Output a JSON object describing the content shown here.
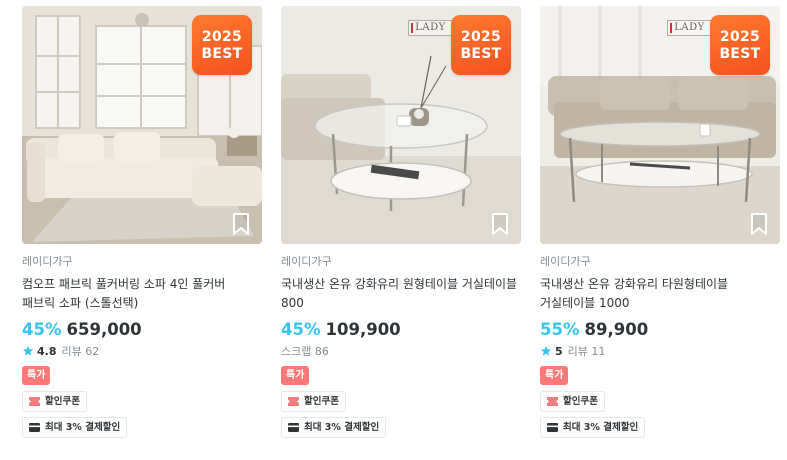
{
  "colors": {
    "discount": "#35c5f0",
    "best_badge": "#f4511e",
    "sale_badge": "#ff7777",
    "star": "#35c5f0",
    "coupon_icon": "#f47b7b",
    "text_muted": "#828c94"
  },
  "products": [
    {
      "badge": {
        "year": "2025",
        "label": "BEST"
      },
      "brand_text": "",
      "seller": "레이디가구",
      "title": "컴오프 패브릭 풀커버링 소파 4인 풀커버 패브릭 소파 (스톨선택)",
      "discount": "45%",
      "price": "659,000",
      "rating": "4.8",
      "review_label": "리뷰 62",
      "sale_tag": "특가",
      "coupon": "할인쿠폰",
      "payment": "최대 3% 결제할인",
      "icon": "bookmark-icon"
    },
    {
      "badge": {
        "year": "2025",
        "label": "BEST"
      },
      "brand_text": "LADY",
      "seller": "레이디가구",
      "title": "국내생산 온유 강화유리 원형테이블 거실테이블 800",
      "discount": "45%",
      "price": "109,900",
      "scrap_label": "스크랩 86",
      "sale_tag": "특가",
      "coupon": "할인쿠폰",
      "payment": "최대 3% 결제할인",
      "icon": "bookmark-icon"
    },
    {
      "badge": {
        "year": "2025",
        "label": "BEST"
      },
      "brand_text": "LADY",
      "seller": "레이디가구",
      "title": "국내생산 온유 강화유리 타원형테이블 거실테이블 1000",
      "discount": "55%",
      "price": "89,900",
      "rating": "5",
      "review_label": "리뷰 11",
      "sale_tag": "특가",
      "coupon": "할인쿠폰",
      "payment": "최대 3% 결제할인",
      "icon": "bookmark-icon"
    }
  ]
}
